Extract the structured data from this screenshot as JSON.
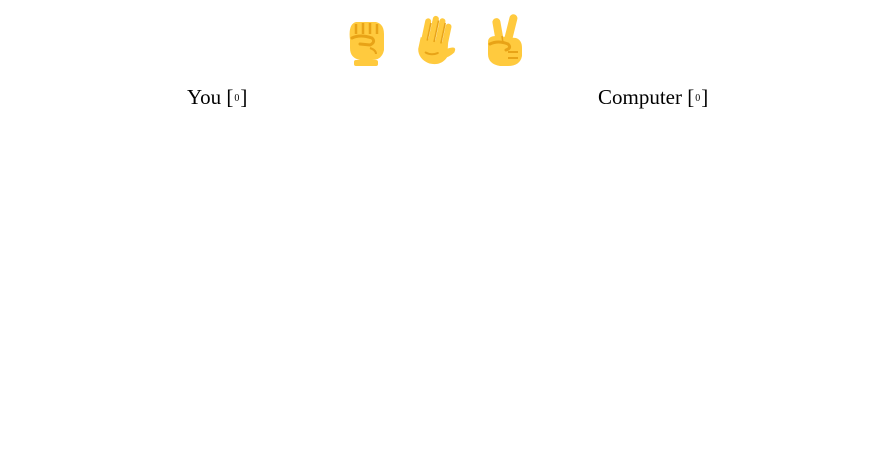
{
  "choices": [
    {
      "name": "rock",
      "icon": "raised-fist-icon"
    },
    {
      "name": "paper",
      "icon": "raised-hand-icon"
    },
    {
      "name": "scissors",
      "icon": "victory-hand-icon"
    }
  ],
  "players": {
    "you": {
      "label": "You",
      "score": "0"
    },
    "computer": {
      "label": "Computer",
      "score": "0"
    }
  },
  "colors": {
    "skin": "#FFCA3E",
    "skin_shade": "#E8A317",
    "text": "#000000",
    "background": "#FFFFFF"
  }
}
